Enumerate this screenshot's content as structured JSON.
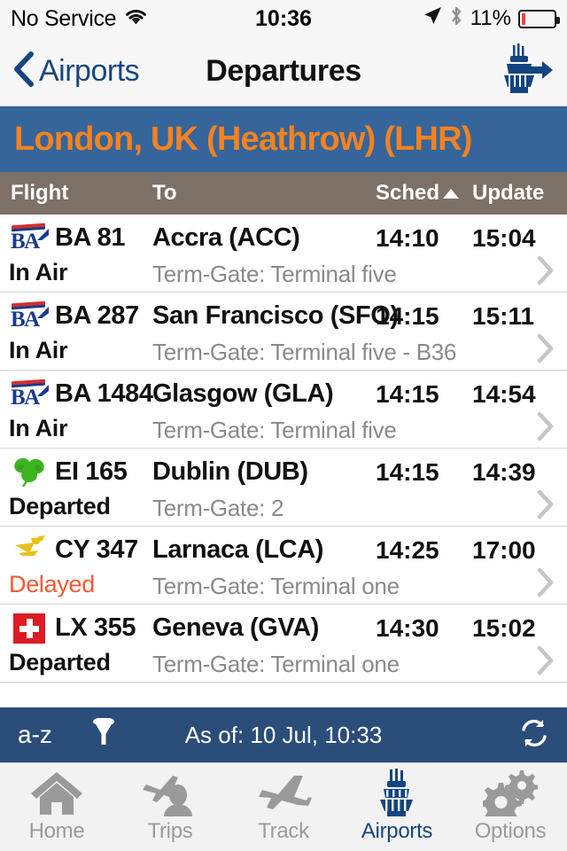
{
  "status_bar": {
    "carrier": "No Service",
    "wifi_icon": "wifi-icon",
    "time": "10:36",
    "location_icon": "location-arrow-icon",
    "bluetooth_icon": "bluetooth-icon",
    "battery_percent": "11%",
    "battery_level": 11
  },
  "nav": {
    "back_label": "Airports",
    "back_icon": "chevron-left-icon",
    "title": "Departures",
    "right_icon": "control-tower-departures-icon"
  },
  "airport": {
    "banner": "London, UK (Heathrow) (LHR)",
    "banner_bg": "#35659b",
    "banner_text_color": "#f58220"
  },
  "columns": {
    "flight": "Flight",
    "to": "To",
    "sched": "Sched",
    "sched_sort_icon": "sort-ascending-triangle-icon",
    "update": "Update",
    "header_bg": "#7d7167"
  },
  "flights": [
    {
      "airline_logo": "british-airways-logo",
      "number": "BA 81",
      "destination": "Accra (ACC)",
      "sched": "14:10",
      "update": "15:04",
      "status": "In Air",
      "status_type": "normal",
      "gate": "Term-Gate: Terminal five"
    },
    {
      "airline_logo": "british-airways-logo",
      "number": "BA 287",
      "destination": "San Francisco (SFO)",
      "sched": "14:15",
      "update": "15:11",
      "status": "In Air",
      "status_type": "normal",
      "gate": "Term-Gate: Terminal five - B36"
    },
    {
      "airline_logo": "british-airways-logo",
      "number": "BA 1484",
      "destination": "Glasgow (GLA)",
      "sched": "14:15",
      "update": "14:54",
      "status": "In Air",
      "status_type": "normal",
      "gate": "Term-Gate: Terminal five"
    },
    {
      "airline_logo": "aer-lingus-shamrock-logo",
      "number": "EI 165",
      "destination": "Dublin (DUB)",
      "sched": "14:15",
      "update": "14:39",
      "status": "Departed",
      "status_type": "normal",
      "gate": "Term-Gate: 2"
    },
    {
      "airline_logo": "cyprus-airways-bird-logo",
      "number": "CY 347",
      "destination": "Larnaca (LCA)",
      "sched": "14:25",
      "update": "17:00",
      "status": "Delayed",
      "status_type": "delayed",
      "gate": "Term-Gate: Terminal one"
    },
    {
      "airline_logo": "swiss-cross-logo",
      "number": "LX 355",
      "destination": "Geneva (GVA)",
      "sched": "14:30",
      "update": "15:02",
      "status": "Departed",
      "status_type": "normal",
      "gate": "Term-Gate: Terminal one"
    }
  ],
  "toolbar": {
    "sort_label": "a-z",
    "filter_icon": "funnel-filter-icon",
    "as_of": "As of: 10 Jul, 10:33",
    "refresh_icon": "refresh-icon",
    "bg": "#2a4d7a"
  },
  "tabs": [
    {
      "label": "Home",
      "icon": "home-icon",
      "active": false
    },
    {
      "label": "Trips",
      "icon": "plane-person-icon",
      "active": false
    },
    {
      "label": "Track",
      "icon": "plane-icon",
      "active": false
    },
    {
      "label": "Airports",
      "icon": "control-tower-icon",
      "active": true
    },
    {
      "label": "Options",
      "icon": "gears-icon",
      "active": false
    }
  ],
  "colors": {
    "accent_blue": "#17457f",
    "banner_orange": "#f58220",
    "delayed": "#f15a32"
  }
}
